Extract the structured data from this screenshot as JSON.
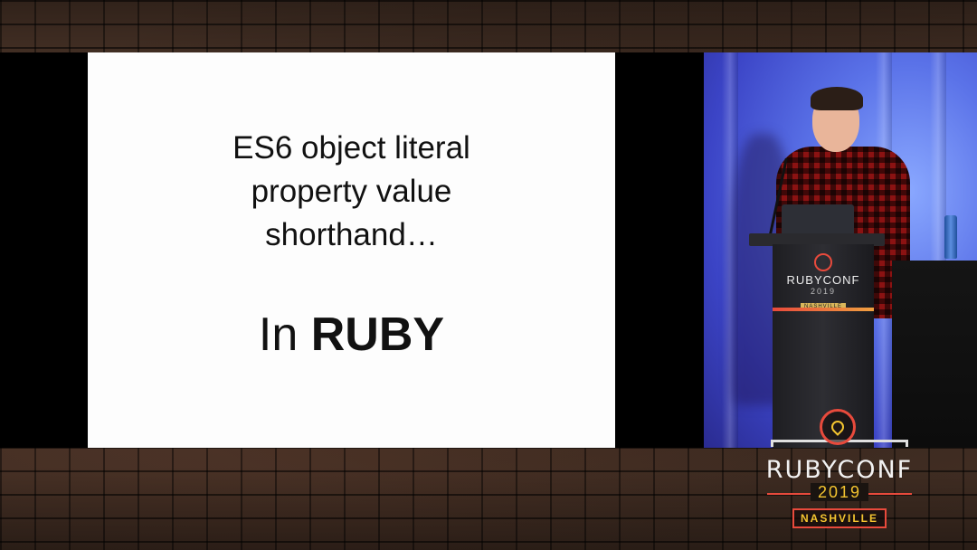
{
  "slide": {
    "heading_lines": [
      "ES6 object literal",
      "property value",
      "shorthand…"
    ],
    "sub_prefix": "In ",
    "sub_bold": "RUBY"
  },
  "podium_logo": {
    "name": "RUBYCONF",
    "year": "2019",
    "city": "NASHVILLE"
  },
  "overlay_logo": {
    "name": "RUBYCONF",
    "year": "2019",
    "city": "NASHVILLE"
  },
  "colors": {
    "brand_red": "#e84a3c",
    "brand_gold": "#f4c430",
    "stage_blue": "#5a72e8",
    "slide_bg": "#fdfdfd"
  }
}
